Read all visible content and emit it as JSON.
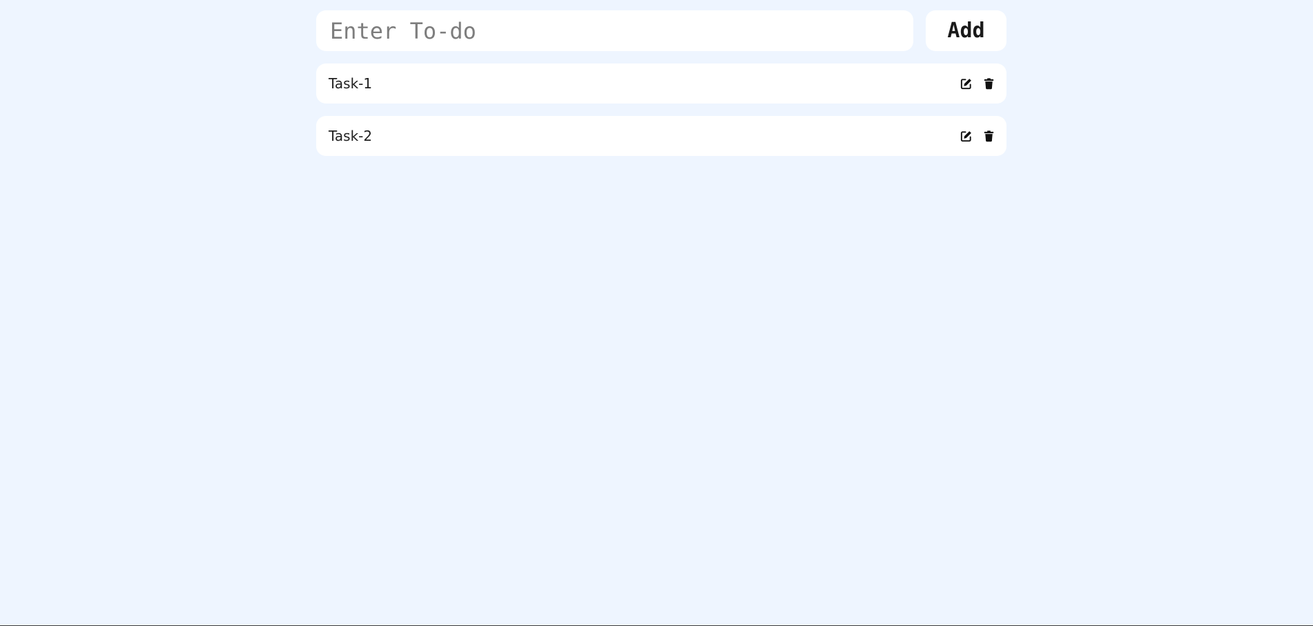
{
  "input": {
    "value": "",
    "placeholder": "Enter To-do"
  },
  "add_button": {
    "label": "Add"
  },
  "todos": [
    {
      "text": "Task-1",
      "edit_icon": "edit-icon",
      "delete_icon": "trash-icon"
    },
    {
      "text": "Task-2",
      "edit_icon": "edit-icon",
      "delete_icon": "trash-icon"
    }
  ],
  "colors": {
    "background": "#eef5ff",
    "card": "#ffffff",
    "text": "#1f1f1f",
    "placeholder": "#7d7d7d"
  }
}
